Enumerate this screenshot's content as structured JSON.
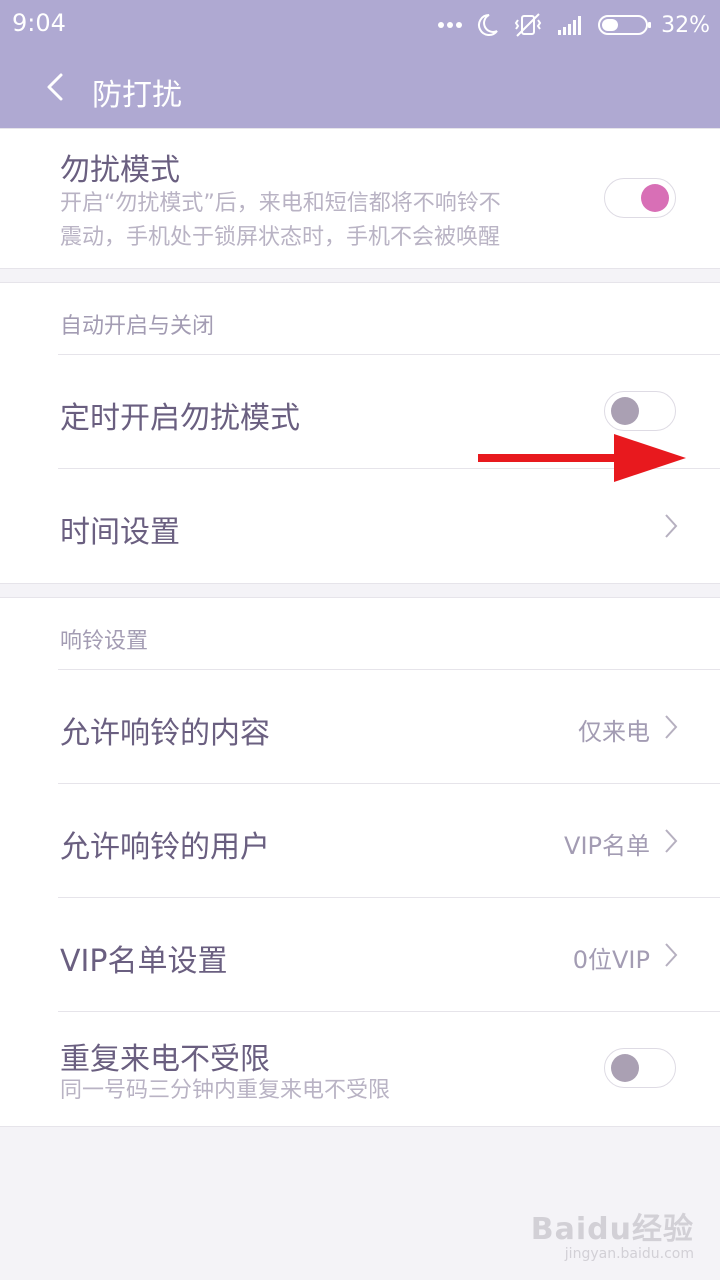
{
  "status_bar": {
    "time": "9:04",
    "battery": "32%",
    "icons": [
      "more-dots-icon",
      "moon-icon",
      "vibrate-off-icon",
      "signal-icon",
      "battery-icon"
    ]
  },
  "app_bar": {
    "title": "防打扰",
    "color": "#afa9d2"
  },
  "dnd": {
    "title": "勿扰模式",
    "desc_line1": "开启“勿扰模式”后，来电和短信都将不响铃不",
    "desc_line2": "震动，手机处于锁屏状态时，手机不会被唤醒",
    "enabled": true
  },
  "auto_section": {
    "header": "自动开启与关闭",
    "scheduled": {
      "title": "定时开启勿扰模式",
      "enabled": false
    },
    "time_settings": {
      "title": "时间设置"
    }
  },
  "ring_section": {
    "header": "响铃设置",
    "allowed_content": {
      "title": "允许响铃的内容",
      "value": "仅来电"
    },
    "allowed_users": {
      "title": "允许响铃的用户",
      "value": "VIP名单"
    },
    "vip_list": {
      "title": "VIP名单设置",
      "value": "0位VIP"
    },
    "repeat_calls": {
      "title": "重复来电不受限",
      "desc": "同一号码三分钟内重复来电不受限",
      "enabled": false
    }
  },
  "colors": {
    "accent_on": "#d86fb6",
    "knob_off": "#aaa0b3",
    "annotation_arrow": "#e8191e"
  },
  "watermark": {
    "main": "Baidu经验",
    "sub": "jingyan.baidu.com"
  }
}
